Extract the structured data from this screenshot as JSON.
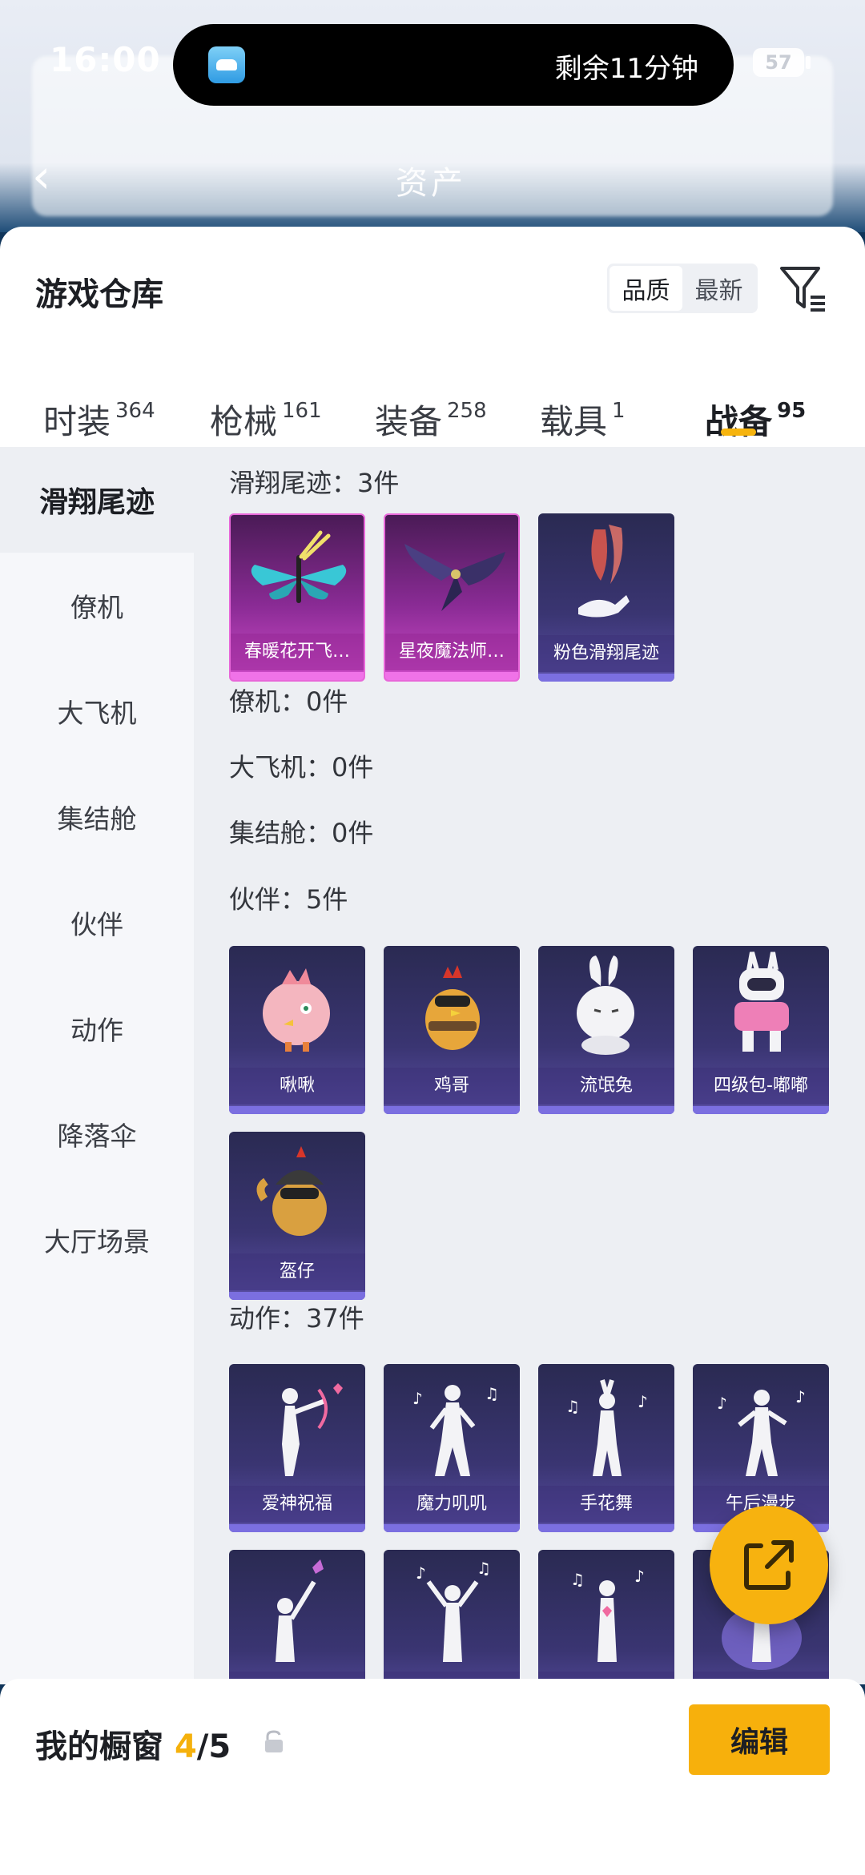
{
  "status_bar": {
    "time": "16:00",
    "battery": "57",
    "live_activity_timer": "剩余11分钟"
  },
  "nav": {
    "title": "资产"
  },
  "warehouse": {
    "title": "游戏仓库",
    "sort_options": [
      "品质",
      "最新"
    ],
    "active_sort": "品质",
    "tabs": [
      {
        "label": "时装",
        "count": "364"
      },
      {
        "label": "枪械",
        "count": "161"
      },
      {
        "label": "装备",
        "count": "258"
      },
      {
        "label": "载具",
        "count": "1"
      },
      {
        "label": "战备",
        "count": "95"
      }
    ],
    "active_tab": "战备",
    "side_nav": [
      "滑翔尾迹",
      "僚机",
      "大飞机",
      "集结舱",
      "伙伴",
      "动作",
      "降落伞",
      "大厅场景"
    ],
    "active_side": "滑翔尾迹",
    "sections": {
      "glide": {
        "label": "滑翔尾迹：3件",
        "items": [
          "春暖花开飞…",
          "星夜魔法师…",
          "粉色滑翔尾迹"
        ]
      },
      "wingman": {
        "label": "僚机：0件"
      },
      "plane": {
        "label": "大飞机：0件"
      },
      "pod": {
        "label": "集结舱：0件"
      },
      "partner": {
        "label": "伙伴：5件",
        "items": [
          "啾啾",
          "鸡哥",
          "流氓兔",
          "四级包-嘟嘟",
          "盔仔"
        ]
      },
      "emote": {
        "label": "动作：37件",
        "items": [
          "爱神祝福",
          "魔力叽叽",
          "手花舞",
          "午后漫步",
          "",
          "",
          "",
          ""
        ]
      }
    }
  },
  "showcase": {
    "label": "我的橱窗",
    "count": "4",
    "total": "/5",
    "edit_label": "编辑"
  },
  "colors": {
    "accent": "#f7b00c",
    "card_purple": "#3a3572",
    "card_magenta": "#8a2b95"
  },
  "icons": [
    "back-arrow-icon",
    "filter-icon",
    "share-external-icon",
    "lock-icon",
    "app-icon"
  ]
}
